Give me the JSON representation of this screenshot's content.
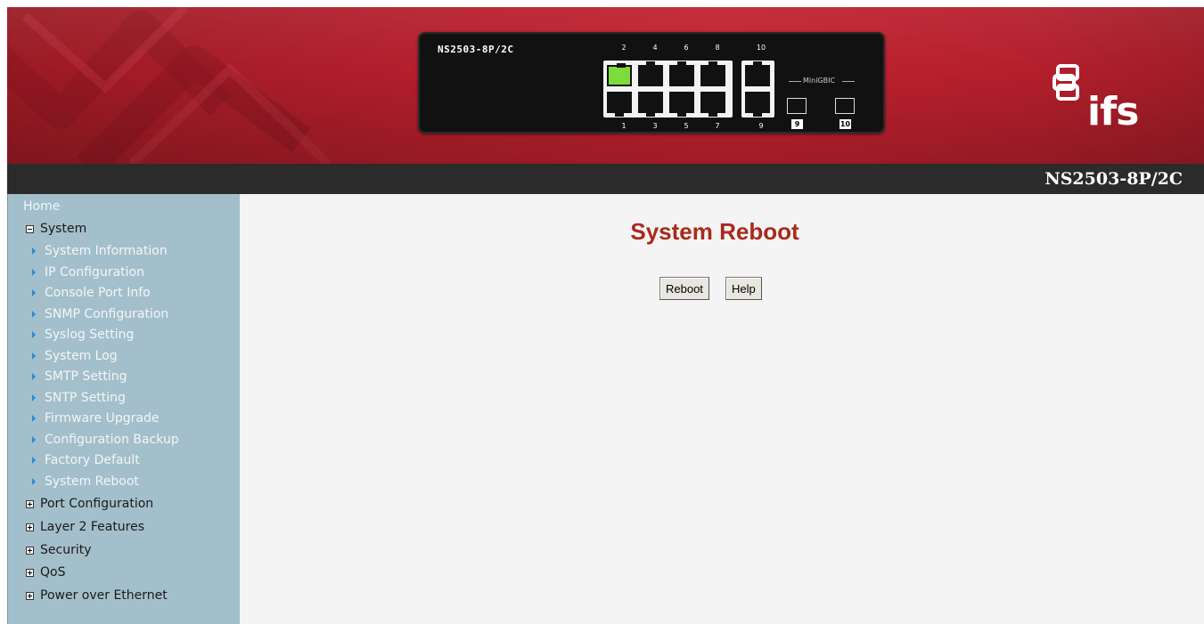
{
  "header": {
    "device_label": "NS2503-8P/2C",
    "brand": "ifs",
    "model_title": "NS2503-8P/2C",
    "active_port": "2",
    "top_port_numbers": [
      "2",
      "4",
      "6",
      "8",
      "10"
    ],
    "bottom_port_numbers": [
      "1",
      "3",
      "5",
      "7",
      "9"
    ],
    "minigbic_label": "MiniGBIC",
    "sfp_numbers": [
      "9",
      "10"
    ]
  },
  "sidebar": {
    "home": "Home",
    "system_group": "System",
    "system_items": [
      "System Information",
      "IP Configuration",
      "Console Port Info",
      "SNMP Configuration",
      "Syslog Setting",
      "System Log",
      "SMTP Setting",
      "SNTP Setting",
      "Firmware Upgrade",
      "Configuration Backup",
      "Factory Default",
      "System Reboot"
    ],
    "collapsed_groups": [
      "Port Configuration",
      "Layer 2 Features",
      "Security",
      "QoS",
      "Power over Ethernet"
    ]
  },
  "main": {
    "title": "System Reboot",
    "reboot_button": "Reboot",
    "help_button": "Help"
  },
  "colors": {
    "banner_red": "#b51f2c",
    "model_bar": "#2b2b2b",
    "sidebar": "#a3bfcb",
    "title_red": "#a82a1c",
    "active_port_green": "#7cdc3c"
  }
}
